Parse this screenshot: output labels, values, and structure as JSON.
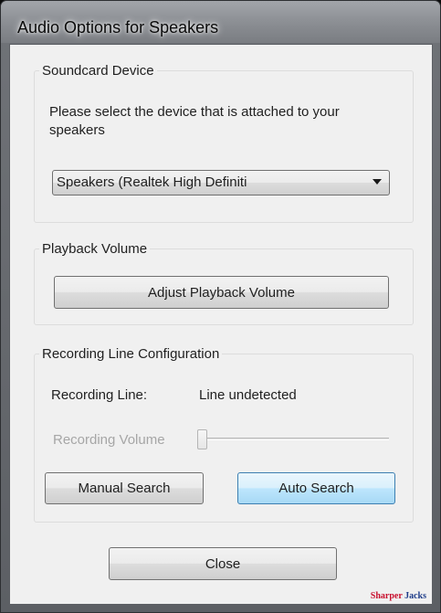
{
  "window": {
    "title": "Audio Options for Speakers"
  },
  "soundcard": {
    "group_label": "Soundcard Device",
    "instructions_line1": "Please select the device that is attached to your",
    "instructions_line2": "speakers",
    "device_selected": "Speakers (Realtek High Definiti"
  },
  "playback": {
    "group_label": "Playback Volume",
    "adjust_button": "Adjust Playback Volume"
  },
  "recording": {
    "group_label": "Recording Line Configuration",
    "line_label": "Recording Line:",
    "line_value": "Line undetected",
    "volume_label": "Recording Volume",
    "volume_level": 0,
    "manual_button": "Manual Search",
    "auto_button": "Auto Search"
  },
  "footer": {
    "close_button": "Close"
  },
  "brand": {
    "word1": "Sharper",
    "word2": "Jacks",
    "color1": "#c8102e",
    "color2": "#1f3d8a"
  },
  "colors": {
    "focus_border": "#3c7fb1",
    "disabled_text": "#a6a6a6"
  }
}
